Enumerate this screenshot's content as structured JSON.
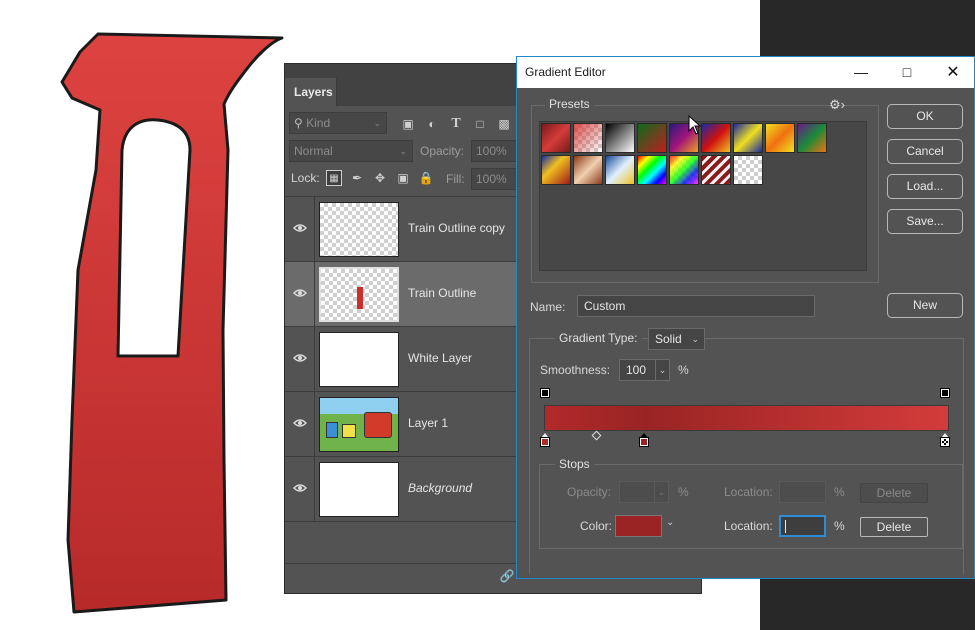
{
  "canvas": {
    "art_color": "#d33c3a"
  },
  "layers_panel": {
    "tab": "Layers",
    "filter_kind": "Kind",
    "blend_mode": "Normal",
    "opacity_label": "Opacity:",
    "opacity_value": "100%",
    "lock_label": "Lock:",
    "fill_label": "Fill:",
    "fill_value": "100%",
    "layers": [
      {
        "name": "Train Outline copy"
      },
      {
        "name": "Train Outline"
      },
      {
        "name": "White Layer"
      },
      {
        "name": "Layer 1"
      },
      {
        "name": "Background"
      }
    ]
  },
  "gradient_editor": {
    "title": "Gradient Editor",
    "presets_label": "Presets",
    "buttons": {
      "ok": "OK",
      "cancel": "Cancel",
      "load": "Load...",
      "save": "Save...",
      "new": "New"
    },
    "name_label": "Name:",
    "name_value": "Custom",
    "gradient_type_label": "Gradient Type:",
    "gradient_type_value": "Solid",
    "smoothness_label": "Smoothness:",
    "smoothness_value": "100",
    "percent": "%",
    "stops_label": "Stops",
    "opacity_label": "Opacity:",
    "location_label": "Location:",
    "delete_label": "Delete",
    "color_label": "Color:",
    "selected_color": "#9a2424",
    "gradient_colors": [
      "#b12a2a",
      "#9a2424",
      "#d33c3a"
    ]
  }
}
